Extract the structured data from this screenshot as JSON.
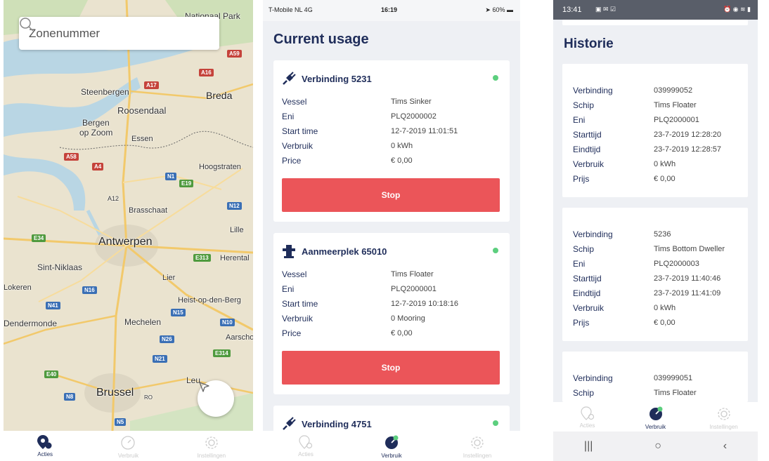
{
  "screen1": {
    "search": {
      "placeholder": "Zonenummer"
    },
    "map_labels": [
      "Nationaal Park",
      "Steenbergen",
      "Breda",
      "Roosendaal",
      "Bergen",
      "op Zoom",
      "Essen",
      "Hoogstraten",
      "Brasschaat",
      "Lille",
      "Antwerpen",
      "Herental",
      "Sint-Niklaas",
      "Lier",
      "Lokeren",
      "Heist-op-den-Berg",
      "Dendermonde",
      "Mechelen",
      "Aarscho",
      "Leu",
      "Brussel",
      "sch",
      "RO"
    ],
    "road_shields": [
      "A59",
      "A16",
      "A17",
      "A58",
      "A4",
      "N1",
      "E19",
      "A12",
      "N12",
      "E34",
      "E313",
      "N16",
      "N41",
      "N15",
      "N10",
      "N26",
      "E314",
      "N21",
      "E40",
      "N8",
      "N5"
    ],
    "tabs": [
      {
        "label": "Acties"
      },
      {
        "label": "Verbruik"
      },
      {
        "label": "Instellingen"
      }
    ]
  },
  "screen2": {
    "status": {
      "carrier": "T-Mobile NL  4G",
      "time": "16:19",
      "battery": "60%"
    },
    "title": "Current usage",
    "cards": [
      {
        "title": "Verbinding 5231",
        "icon": "plug-icon",
        "rows": [
          [
            "Vessel",
            "Tims Sinker"
          ],
          [
            "Eni",
            "PLQ2000002"
          ],
          [
            "Start time",
            "12-7-2019 11:01:51"
          ],
          [
            "Verbruik",
            "0 kWh"
          ],
          [
            "Price",
            "€ 0,00"
          ]
        ],
        "button": "Stop"
      },
      {
        "title": "Aanmeerplek 65010",
        "icon": "bollard-icon",
        "rows": [
          [
            "Vessel",
            "Tims Floater"
          ],
          [
            "Eni",
            "PLQ2000001"
          ],
          [
            "Start time",
            "12-7-2019 10:18:16"
          ],
          [
            "Verbruik",
            "0 Mooring"
          ],
          [
            "Price",
            "€ 0,00"
          ]
        ],
        "button": "Stop"
      },
      {
        "title": "Verbinding 4751",
        "icon": "plug-icon"
      }
    ],
    "tabs": [
      {
        "label": "Acties"
      },
      {
        "label": "Verbruik"
      },
      {
        "label": "Instellingen"
      }
    ]
  },
  "screen3": {
    "status": {
      "time": "13:41"
    },
    "title": "Historie",
    "cards": [
      {
        "rows": [
          [
            "Verbinding",
            "039999052"
          ],
          [
            "Schip",
            "Tims Floater"
          ],
          [
            "Eni",
            "PLQ2000001"
          ],
          [
            "Starttijd",
            "23-7-2019 12:28:20"
          ],
          [
            "Eindtijd",
            "23-7-2019 12:28:57"
          ],
          [
            "Verbruik",
            "0 kWh"
          ],
          [
            "Prijs",
            "€ 0,00"
          ]
        ]
      },
      {
        "rows": [
          [
            "Verbinding",
            "5236"
          ],
          [
            "Schip",
            "Tims Bottom Dweller"
          ],
          [
            "Eni",
            "PLQ2000003"
          ],
          [
            "Starttijd",
            "23-7-2019 11:40:46"
          ],
          [
            "Eindtijd",
            "23-7-2019 11:41:09"
          ],
          [
            "Verbruik",
            "0 kWh"
          ],
          [
            "Prijs",
            "€ 0,00"
          ]
        ]
      },
      {
        "rows": [
          [
            "Verbinding",
            "039999051"
          ],
          [
            "Schip",
            "Tims Floater"
          ]
        ]
      }
    ],
    "tabs": [
      {
        "label": "Acties"
      },
      {
        "label": "Verbruik"
      },
      {
        "label": "Instellingen"
      }
    ],
    "nav": {
      "recent": "|||",
      "home": "○",
      "back": "‹"
    }
  },
  "colors": {
    "navy": "#1f2d5a",
    "stop": "#eb5559",
    "active_dot": "#5ccf7e",
    "map_bg": "#eae3cf",
    "water": "#b9d6e4"
  }
}
